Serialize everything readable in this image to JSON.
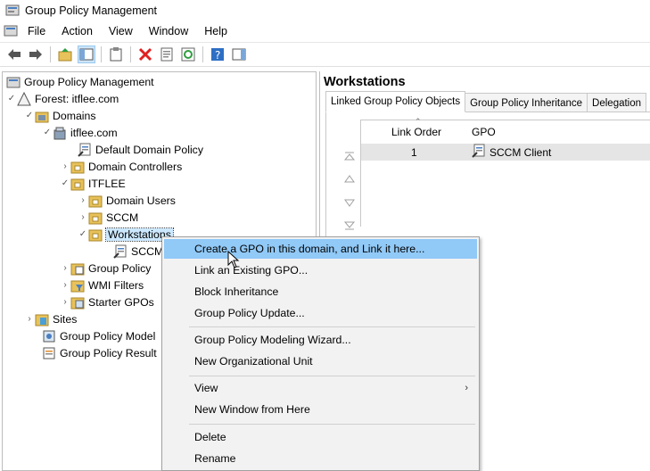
{
  "window": {
    "title": "Group Policy Management"
  },
  "menubar": [
    "File",
    "Action",
    "View",
    "Window",
    "Help"
  ],
  "tree": {
    "root": "Group Policy Management",
    "forest": "Forest: itflee.com",
    "domains": "Domains",
    "domain": "itflee.com",
    "ddp": "Default Domain Policy",
    "dc": "Domain Controllers",
    "itflee": "ITFLEE",
    "domain_users": "Domain Users",
    "sccm": "SCCM",
    "workstations": "Workstations",
    "sccm_client_trunc": "SCCM",
    "gpo_objects": "Group Policy",
    "wmi": "WMI Filters",
    "starter": "Starter GPOs",
    "sites": "Sites",
    "modeling": "Group Policy Model",
    "results": "Group Policy Result"
  },
  "right": {
    "title": "Workstations",
    "tabs": [
      "Linked Group Policy Objects",
      "Group Policy Inheritance",
      "Delegation"
    ],
    "columns": {
      "link_order": "Link Order",
      "gpo": "GPO"
    },
    "rows": [
      {
        "link_order": "1",
        "gpo": "SCCM Client"
      }
    ]
  },
  "context_menu": {
    "create": "Create a GPO in this domain, and Link it here...",
    "link": "Link an Existing GPO...",
    "block": "Block Inheritance",
    "update": "Group Policy Update...",
    "wizard": "Group Policy Modeling Wizard...",
    "new_ou": "New Organizational Unit",
    "view": "View",
    "new_window": "New Window from Here",
    "delete": "Delete",
    "rename": "Rename"
  },
  "colors": {
    "highlight": "#91c9f7",
    "selection": "#cce8ff"
  }
}
